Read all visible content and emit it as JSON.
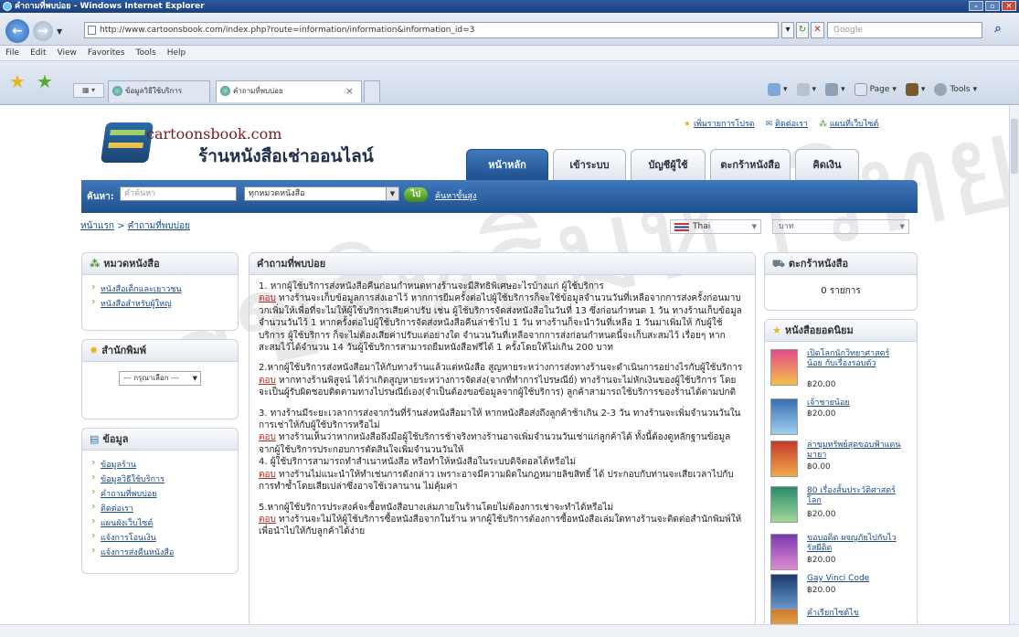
{
  "window": {
    "title": "คำถามที่พบบ่อย - Windows Internet Explorer"
  },
  "browser": {
    "url": "http://www.cartoonsbook.com/index.php?route=information/information&information_id=3",
    "search_placeholder": "Google",
    "menu": [
      "File",
      "Edit",
      "View",
      "Favorites",
      "Tools",
      "Help"
    ],
    "tabs": [
      {
        "label": "ข้อมูลวิธีใช้บริการ"
      },
      {
        "label": "คำถามที่พบบ่อย"
      }
    ],
    "commands": {
      "page": "Page",
      "tools": "Tools"
    }
  },
  "site": {
    "name": "cartoonsbook.com",
    "tagline": "ร้านหนังสือเช่าออนไลน์",
    "toplinks": [
      "เพิ่มรายการโปรด",
      "ติดต่อเรา",
      "แผนที่เว็บไซต์"
    ],
    "main_tabs": [
      "หน้าหลัก",
      "เข้าระบบ",
      "บัญชีผู้ใช้",
      "ตะกร้าหนังสือ",
      "คิดเงิน"
    ],
    "search": {
      "label": "ค้นหา:",
      "placeholder": "คำค้นหา",
      "category": "ทุกหมวดหนังสือ",
      "go": "ไป",
      "advanced": "ค้นหาขั้นสูง"
    },
    "breadcrumb": {
      "home": "หน้าแรก",
      "sep": " > ",
      "current": "คำถามที่พบบ่อย"
    },
    "language": "Thai",
    "currency": "บาท"
  },
  "left": {
    "categories": {
      "title": "หมวดหนังสือ",
      "items": [
        "หนังสือเด็กและเยาวชน",
        "หนังสือสำหรับผู้ใหญ่"
      ]
    },
    "publishers": {
      "title": "สำนักพิมพ์",
      "select": "--- กรุณาเลือก ---"
    },
    "info": {
      "title": "ข้อมูล",
      "items": [
        "ข้อมูลร้าน",
        "ข้อมูลวิธีใช้บริการ",
        "คำถามที่พบบ่อย",
        "ติดต่อเรา",
        "แผนผังเว็บไซต์",
        "แจ้งการโอนเงิน",
        "แจ้งการส่งคืนหนังสือ"
      ]
    }
  },
  "faq": {
    "title": "คำถามที่พบบ่อย",
    "answer_label": "ตอบ",
    "items": [
      {
        "q": "1. หากผู้ใช้บริการส่งหนังสือคืนก่อนกำหนดทางร้านจะมีสิทธิพิเศษอะไรบ้างแก่ ผู้ใช้บริการ",
        "a": "ทางร้านจะเก็บข้อมูลการส่งเอาไว้ หากการยืมครั้งต่อไปผู้ใช้บริการก็จะใช้ข้อมูลจำนวนวันที่เหลือจากการส่งครั้งก่อนมาบวกเพิ่มให้เพื่อที่จะไม่ให้ผู้ใช้บริการเสียค่าปรับ เช่น ผู้ใช้บริการจัดส่งหนังสือในวันที่ 13 ซึ่งก่อนกำหนด 1 วัน ทางร้านเก็บข้อมูลจำนวนวันไว้ 1 หากครั้งต่อไปผู้ใช้บริการจัดส่งหนังสือคืนล่าช้าไป 1 วัน ทางร้านก็จะนำวันที่เหลือ 1 วันมาเพิ่มให้ กับผู้ใช้บริการ ผู้ใช้บริการ ก็จะไม่ต้องเสียค่าปรับแต่อย่างใด จำนวนวันที่เหลือจากการส่งก่อนกำหนดนี้จะเก็บสะสมไว้ เรื่อยๆ หากสะสมไว้ได้จำนวน 14 วันผู้ใช้บริการสามารถยืมหนังสือฟรีได้ 1 ครั้งโดยให้ไม่เกิน 200 บาท"
      },
      {
        "q": "2.หากผู้ใช้บริการส่งหนังสือมาให้กับทางร้านแล้วแต่หนังสือ สูญหายระหว่างการส่งทางร้านจะดำเนินการอย่างไรกับผู้ใช้บริการ",
        "a": "หากทางร้านพิสูจน์ ได้ว่าเกิดสูญหายระหว่างการจัดส่ง(จากที่ทำการไปรษณีย์) ทางร้านจะไม่หักเงินของผู้ใช้บริการ โดยจะเป็นผู้รับผิดชอบติดตามทางไปรษณีย์เอง(จำเป็นต้องขอข้อมูลจากผู้ใช้บริการ) ลูกค้าสามารถใช้บริการของร้านได้ตามปกติ"
      },
      {
        "q": "3. ทางร้านมีระยะเวลาการส่งจากวันที่ร้านส่งหนังสือมาให้ หากหนังสือส่งถึงลูกค้าช้าเกิน 2-3 วัน ทางร้านจะเพิ่มจำนวนวันในการเช่าให้กับผู้ใช้บริการหรือไม่",
        "a": "ทางร้านเห็นว่าหากหนังสือถึงมือผู้ใช้บริการช้าจริงทางร้านอาจเพิ่มจำนวนวันเช่าแก่ลูกค้าได้ ทั้งนี้ต้องดูหลักฐานข้อมูลจากผู้ใช้บริการประกอบการตัดสินใจเพิ่มจำนวนวันให้"
      },
      {
        "q": "4. ผู้ใช้บริการสามารถทำสำเนาหนังสือ หรือทำให้หนังสือในระบบดิจิตอลได้หรือไม่",
        "a": "ทางร้านไม่แนะนำให้ทำเช่นการดังกล่าว เพราะอาจมีความผิดในกฎหมายลิขสิทธิ์ ได้ ประกอบกับท่านจะเสียเวลาไปกับการทำซ้ำโดยเสียเปล่าซึ่งอาจใช้เวลานาน ไม่คุ้มค่า"
      },
      {
        "q": "5.หากผู้ใช้บริการประสงค์จะซื้อหนังสือบางเล่มภายในร้านโดยไม่ต้องการเช่าจะทำได้หรือไม่",
        "a": "ทางร้านจะไม่ให้ผู้ใช้บริการซื้อหนังสือจากในร้าน หากผู้ใช้บริการต้องการซื้อหนังสือเล่มใดทางร้านจะติดต่อสำนักพิมพ์ให้เพื่อนำไปให้กับลูกค้าได้ง่าย"
      }
    ]
  },
  "right": {
    "cart": {
      "title": "ตะกร้าหนังสือ",
      "count": "0 รายการ"
    },
    "popular": {
      "title": "หนังสือยอดนิยม",
      "books": [
        {
          "title": "เปิดโลกนักวิทยาศาสตร์น้อย กับเรื่องรอบตัว",
          "price": "฿20.00"
        },
        {
          "title": "เจ้าชายน้อย",
          "price": "฿20.00"
        },
        {
          "title": "ล่าขุมทรัพย์สุดขอบฟ้าแดนมายา",
          "price": "฿0.00"
        },
        {
          "title": "80 เรื่องสั้นประวัติศาสตร์โลก",
          "price": "฿20.00"
        },
        {
          "title": "ขอบอดิต ผจญภัยไปกับไวรัสผีดิด",
          "price": "฿20.00"
        },
        {
          "title": "Gay Vinci Code",
          "price": "฿20.00"
        },
        {
          "title": "คำเรียกไซต์ไข",
          "price": ""
        }
      ]
    }
  },
  "watermark": "ลิขสิทธิ์มหาวิทยาลัยเชียงใหม่"
}
